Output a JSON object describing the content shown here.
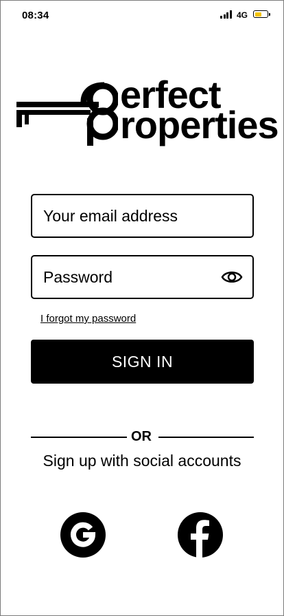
{
  "status_bar": {
    "time": "08:34",
    "network": "4G",
    "battery_level": 0.45,
    "battery_color": "#f2c200"
  },
  "logo": {
    "line1": "erfect",
    "line2": "roperties",
    "icon": "key-icon"
  },
  "login_form": {
    "email_placeholder": "Your email address",
    "password_placeholder": "Password",
    "password_toggle_icon": "eye-icon",
    "forgot_link": "I forgot my password",
    "sign_in_label": "SIGN IN"
  },
  "social": {
    "divider_text": "OR",
    "heading": "Sign up with social accounts",
    "providers": [
      {
        "name": "google",
        "icon": "google-icon"
      },
      {
        "name": "facebook",
        "icon": "facebook-icon"
      }
    ]
  },
  "colors": {
    "primary": "#000000",
    "background": "#ffffff",
    "button_text": "#ffffff"
  }
}
